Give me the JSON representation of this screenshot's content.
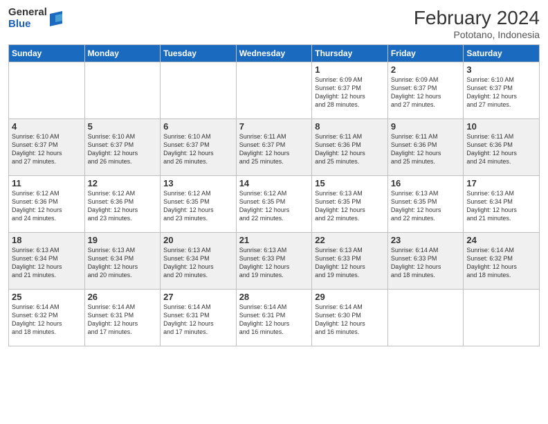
{
  "header": {
    "logo_general": "General",
    "logo_blue": "Blue",
    "month_title": "February 2024",
    "location": "Pototano, Indonesia"
  },
  "weekdays": [
    "Sunday",
    "Monday",
    "Tuesday",
    "Wednesday",
    "Thursday",
    "Friday",
    "Saturday"
  ],
  "weeks": [
    [
      {
        "day": "",
        "info": ""
      },
      {
        "day": "",
        "info": ""
      },
      {
        "day": "",
        "info": ""
      },
      {
        "day": "",
        "info": ""
      },
      {
        "day": "1",
        "info": "Sunrise: 6:09 AM\nSunset: 6:37 PM\nDaylight: 12 hours\nand 28 minutes."
      },
      {
        "day": "2",
        "info": "Sunrise: 6:09 AM\nSunset: 6:37 PM\nDaylight: 12 hours\nand 27 minutes."
      },
      {
        "day": "3",
        "info": "Sunrise: 6:10 AM\nSunset: 6:37 PM\nDaylight: 12 hours\nand 27 minutes."
      }
    ],
    [
      {
        "day": "4",
        "info": "Sunrise: 6:10 AM\nSunset: 6:37 PM\nDaylight: 12 hours\nand 27 minutes."
      },
      {
        "day": "5",
        "info": "Sunrise: 6:10 AM\nSunset: 6:37 PM\nDaylight: 12 hours\nand 26 minutes."
      },
      {
        "day": "6",
        "info": "Sunrise: 6:10 AM\nSunset: 6:37 PM\nDaylight: 12 hours\nand 26 minutes."
      },
      {
        "day": "7",
        "info": "Sunrise: 6:11 AM\nSunset: 6:37 PM\nDaylight: 12 hours\nand 25 minutes."
      },
      {
        "day": "8",
        "info": "Sunrise: 6:11 AM\nSunset: 6:36 PM\nDaylight: 12 hours\nand 25 minutes."
      },
      {
        "day": "9",
        "info": "Sunrise: 6:11 AM\nSunset: 6:36 PM\nDaylight: 12 hours\nand 25 minutes."
      },
      {
        "day": "10",
        "info": "Sunrise: 6:11 AM\nSunset: 6:36 PM\nDaylight: 12 hours\nand 24 minutes."
      }
    ],
    [
      {
        "day": "11",
        "info": "Sunrise: 6:12 AM\nSunset: 6:36 PM\nDaylight: 12 hours\nand 24 minutes."
      },
      {
        "day": "12",
        "info": "Sunrise: 6:12 AM\nSunset: 6:36 PM\nDaylight: 12 hours\nand 23 minutes."
      },
      {
        "day": "13",
        "info": "Sunrise: 6:12 AM\nSunset: 6:35 PM\nDaylight: 12 hours\nand 23 minutes."
      },
      {
        "day": "14",
        "info": "Sunrise: 6:12 AM\nSunset: 6:35 PM\nDaylight: 12 hours\nand 22 minutes."
      },
      {
        "day": "15",
        "info": "Sunrise: 6:13 AM\nSunset: 6:35 PM\nDaylight: 12 hours\nand 22 minutes."
      },
      {
        "day": "16",
        "info": "Sunrise: 6:13 AM\nSunset: 6:35 PM\nDaylight: 12 hours\nand 22 minutes."
      },
      {
        "day": "17",
        "info": "Sunrise: 6:13 AM\nSunset: 6:34 PM\nDaylight: 12 hours\nand 21 minutes."
      }
    ],
    [
      {
        "day": "18",
        "info": "Sunrise: 6:13 AM\nSunset: 6:34 PM\nDaylight: 12 hours\nand 21 minutes."
      },
      {
        "day": "19",
        "info": "Sunrise: 6:13 AM\nSunset: 6:34 PM\nDaylight: 12 hours\nand 20 minutes."
      },
      {
        "day": "20",
        "info": "Sunrise: 6:13 AM\nSunset: 6:34 PM\nDaylight: 12 hours\nand 20 minutes."
      },
      {
        "day": "21",
        "info": "Sunrise: 6:13 AM\nSunset: 6:33 PM\nDaylight: 12 hours\nand 19 minutes."
      },
      {
        "day": "22",
        "info": "Sunrise: 6:13 AM\nSunset: 6:33 PM\nDaylight: 12 hours\nand 19 minutes."
      },
      {
        "day": "23",
        "info": "Sunrise: 6:14 AM\nSunset: 6:33 PM\nDaylight: 12 hours\nand 18 minutes."
      },
      {
        "day": "24",
        "info": "Sunrise: 6:14 AM\nSunset: 6:32 PM\nDaylight: 12 hours\nand 18 minutes."
      }
    ],
    [
      {
        "day": "25",
        "info": "Sunrise: 6:14 AM\nSunset: 6:32 PM\nDaylight: 12 hours\nand 18 minutes."
      },
      {
        "day": "26",
        "info": "Sunrise: 6:14 AM\nSunset: 6:31 PM\nDaylight: 12 hours\nand 17 minutes."
      },
      {
        "day": "27",
        "info": "Sunrise: 6:14 AM\nSunset: 6:31 PM\nDaylight: 12 hours\nand 17 minutes."
      },
      {
        "day": "28",
        "info": "Sunrise: 6:14 AM\nSunset: 6:31 PM\nDaylight: 12 hours\nand 16 minutes."
      },
      {
        "day": "29",
        "info": "Sunrise: 6:14 AM\nSunset: 6:30 PM\nDaylight: 12 hours\nand 16 minutes."
      },
      {
        "day": "",
        "info": ""
      },
      {
        "day": "",
        "info": ""
      }
    ]
  ]
}
